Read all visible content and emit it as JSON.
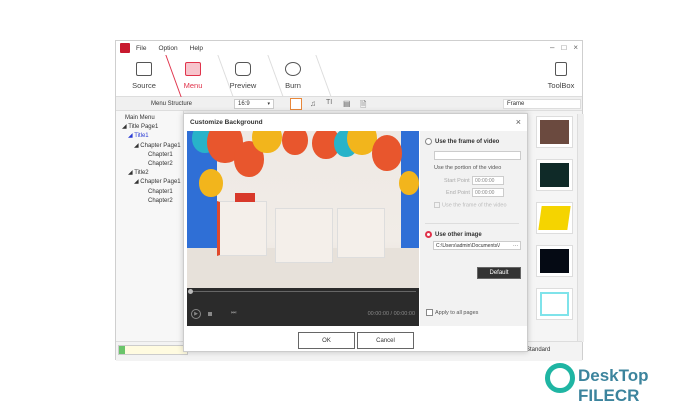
{
  "menu": [
    "File",
    "Option",
    "Help"
  ],
  "steps": [
    {
      "label": "Source"
    },
    {
      "label": "Menu"
    },
    {
      "label": "Preview"
    },
    {
      "label": "Burn"
    }
  ],
  "toolbox": "ToolBox",
  "toolbar": {
    "menu_structure": "Menu Structure",
    "aspect": "16:9",
    "frame_label": "Frame"
  },
  "tree": [
    "Main Menu",
    "Title Page1",
    "Title1",
    "Chapter Page1",
    "Chapter1",
    "Chapter2",
    "Title2",
    "Chapter Page1",
    "Chapter1",
    "Chapter2"
  ],
  "dialog": {
    "title": "Customize Background",
    "time": "00:00:00 / 00:00:00",
    "use_frame": "Use the frame of video",
    "use_portion": "Use the portion of the video",
    "start_label": "Start Point",
    "start_value": "00:00:00",
    "end_label": "End Point",
    "end_value": "00:00:00",
    "use_frame_check": "Use the frame of the video",
    "use_other": "Use other image",
    "path": "C:\\Users\\admin\\Documents\\/",
    "browse": "···",
    "default": "Default",
    "apply_all": "Apply to all pages",
    "ok": "OK",
    "cancel": "Cancel"
  },
  "status": {
    "quality": "Standard"
  },
  "frame_colors": [
    "#6b4a3f",
    "#0f2a28",
    "#f5d400",
    "#050a14",
    "#7fe3ea"
  ],
  "watermark": "DeskTop FILECR"
}
